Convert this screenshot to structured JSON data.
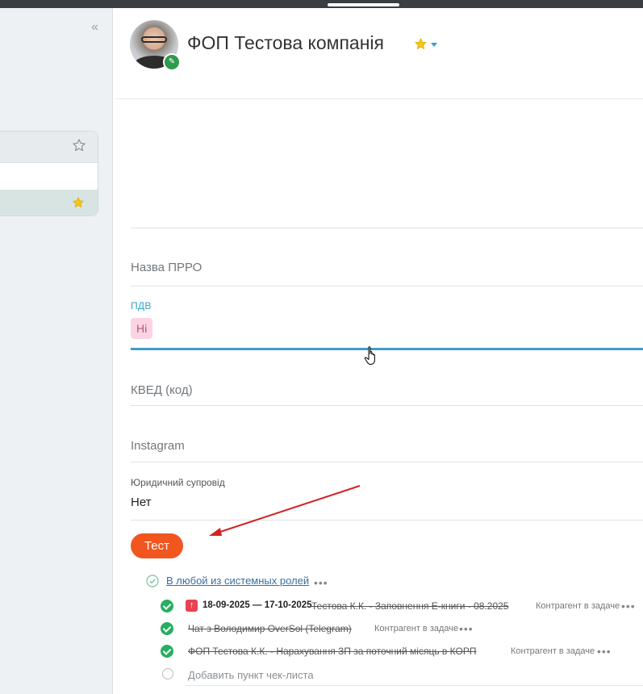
{
  "sidebar": {
    "collapse_glyph": "«"
  },
  "header": {
    "title": "ФОП Тестова компанія",
    "edit_glyph": "✎",
    "star_color": "#f5c518",
    "caret_color": "#2fa4c6"
  },
  "fields": {
    "prro_label": "Назва ПРРО",
    "pdv_label": "ПДВ",
    "pdv_value": "Ні",
    "kved_label": "КВЕД (код)",
    "instagram_label": "Instagram",
    "legal_label": "Юридичний супровід",
    "legal_value": "Нет"
  },
  "test_button": {
    "label": "Тест",
    "color": "#f1561f"
  },
  "checklist": {
    "group_label": "В любой из системных ролей",
    "more": "•••",
    "tasks": [
      {
        "priority_glyph": "↑",
        "date": "18-09-2025 — 17-10-2025",
        "title": "Тестова К.К. - Заповнення Е-книги - 08.2025",
        "meta": "Контрагент в задаче",
        "more": "•••"
      },
      {
        "title": "Чат з Володимир OverSol (Telegram)",
        "meta": "Контрагент в задаче",
        "more": "•••"
      },
      {
        "title": "ФОП Тестова К.К. - Нарахування ЗП за поточний місяць в КОРП",
        "meta": "Контрагент в задаче",
        "more": "•••"
      }
    ],
    "add_item_placeholder": "Добавить пункт чек-листа"
  }
}
